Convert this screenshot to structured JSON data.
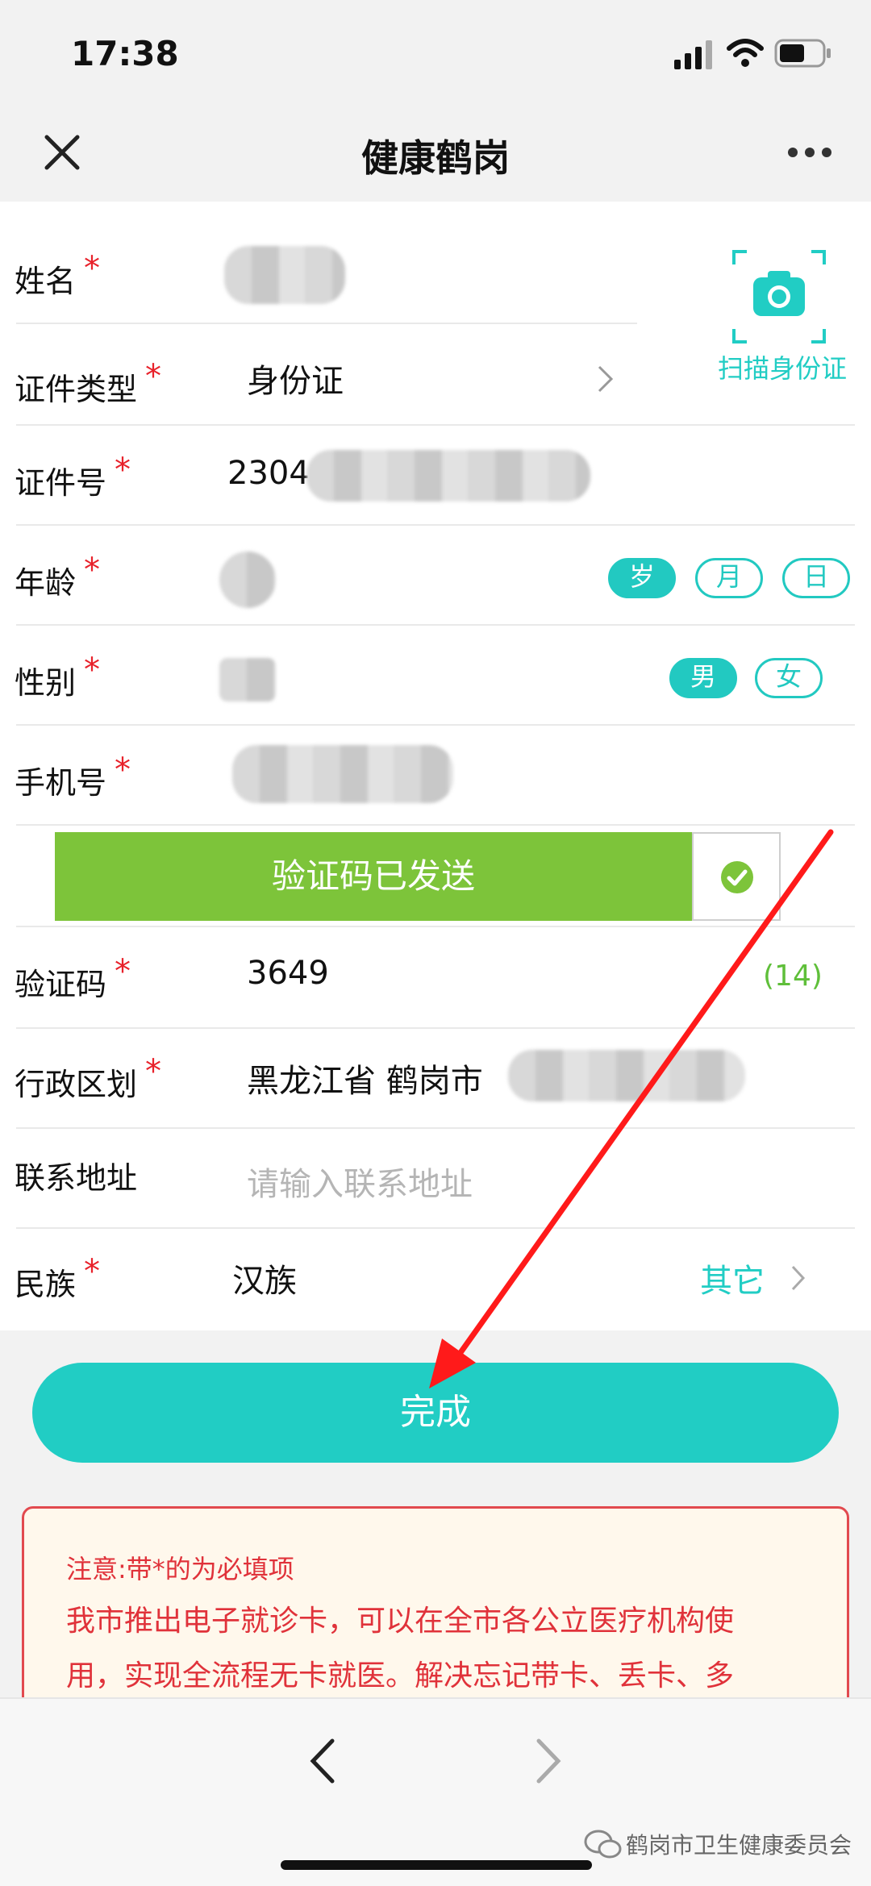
{
  "status": {
    "time": "17:38"
  },
  "header": {
    "title": "健康鹤岗"
  },
  "scan": {
    "label": "扫描身份证"
  },
  "form": {
    "name": {
      "label": "姓名"
    },
    "id_type": {
      "label": "证件类型",
      "value": "身份证"
    },
    "id_number": {
      "label": "证件号",
      "value_prefix": "2304"
    },
    "age": {
      "label": "年龄",
      "units": [
        "岁",
        "月",
        "日"
      ]
    },
    "gender": {
      "label": "性别",
      "options": [
        "男",
        "女"
      ]
    },
    "phone": {
      "label": "手机号"
    },
    "verify": {
      "sent_label": "验证码已发送"
    },
    "code": {
      "label": "验证码",
      "value": "3649",
      "countdown": "(14)"
    },
    "region": {
      "label": "行政区划",
      "value": "黑龙江省 鹤岗市"
    },
    "address": {
      "label": "联系地址",
      "placeholder": "请输入联系地址"
    },
    "ethnicity": {
      "label": "民族",
      "value": "汉族",
      "other": "其它"
    }
  },
  "submit": {
    "label": "完成"
  },
  "notice": {
    "title": "注意:带*的为必填项",
    "body_line1": "我市推出电子就诊卡，可以在全市各公立医疗机构使",
    "body_line2": "用，实现全流程无卡就医。解决忘记带卡、丢卡、多"
  },
  "watermark": {
    "text": "鹤岗市卫生健康委员会"
  },
  "colors": {
    "accent": "#21cdc4",
    "verify_green": "#7dc43a",
    "required_red": "#e8222b",
    "arrow_red": "#ff1a1a"
  }
}
